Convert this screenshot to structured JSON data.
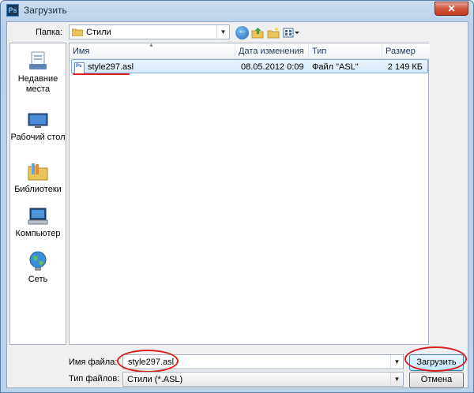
{
  "window": {
    "title": "Загрузить",
    "app_icon_text": "Ps",
    "close_symbol": "✕"
  },
  "location": {
    "label": "Папка:",
    "current_folder": "Стили"
  },
  "places": [
    {
      "label": "Недавние места",
      "icon": "recent-places-icon"
    },
    {
      "label": "Рабочий стол",
      "icon": "desktop-icon"
    },
    {
      "label": "Библиотеки",
      "icon": "libraries-icon"
    },
    {
      "label": "Компьютер",
      "icon": "computer-icon"
    },
    {
      "label": "Сеть",
      "icon": "network-icon"
    }
  ],
  "columns": {
    "name": "Имя",
    "date": "Дата изменения",
    "type": "Тип",
    "size": "Размер"
  },
  "files": [
    {
      "name": "style297.asl",
      "date": "08.05.2012 0:09",
      "type": "Файл \"ASL\"",
      "size": "2 149 КБ"
    }
  ],
  "form": {
    "filename_label": "Имя файла:",
    "filename_value": "style297.asl",
    "filetype_label": "Тип файлов:",
    "filetype_value": "Стили (*.ASL)",
    "open_button": "Загрузить",
    "cancel_button": "Отмена"
  },
  "accent": {
    "highlight": "#d92020",
    "selection": "#d5e9fb"
  }
}
